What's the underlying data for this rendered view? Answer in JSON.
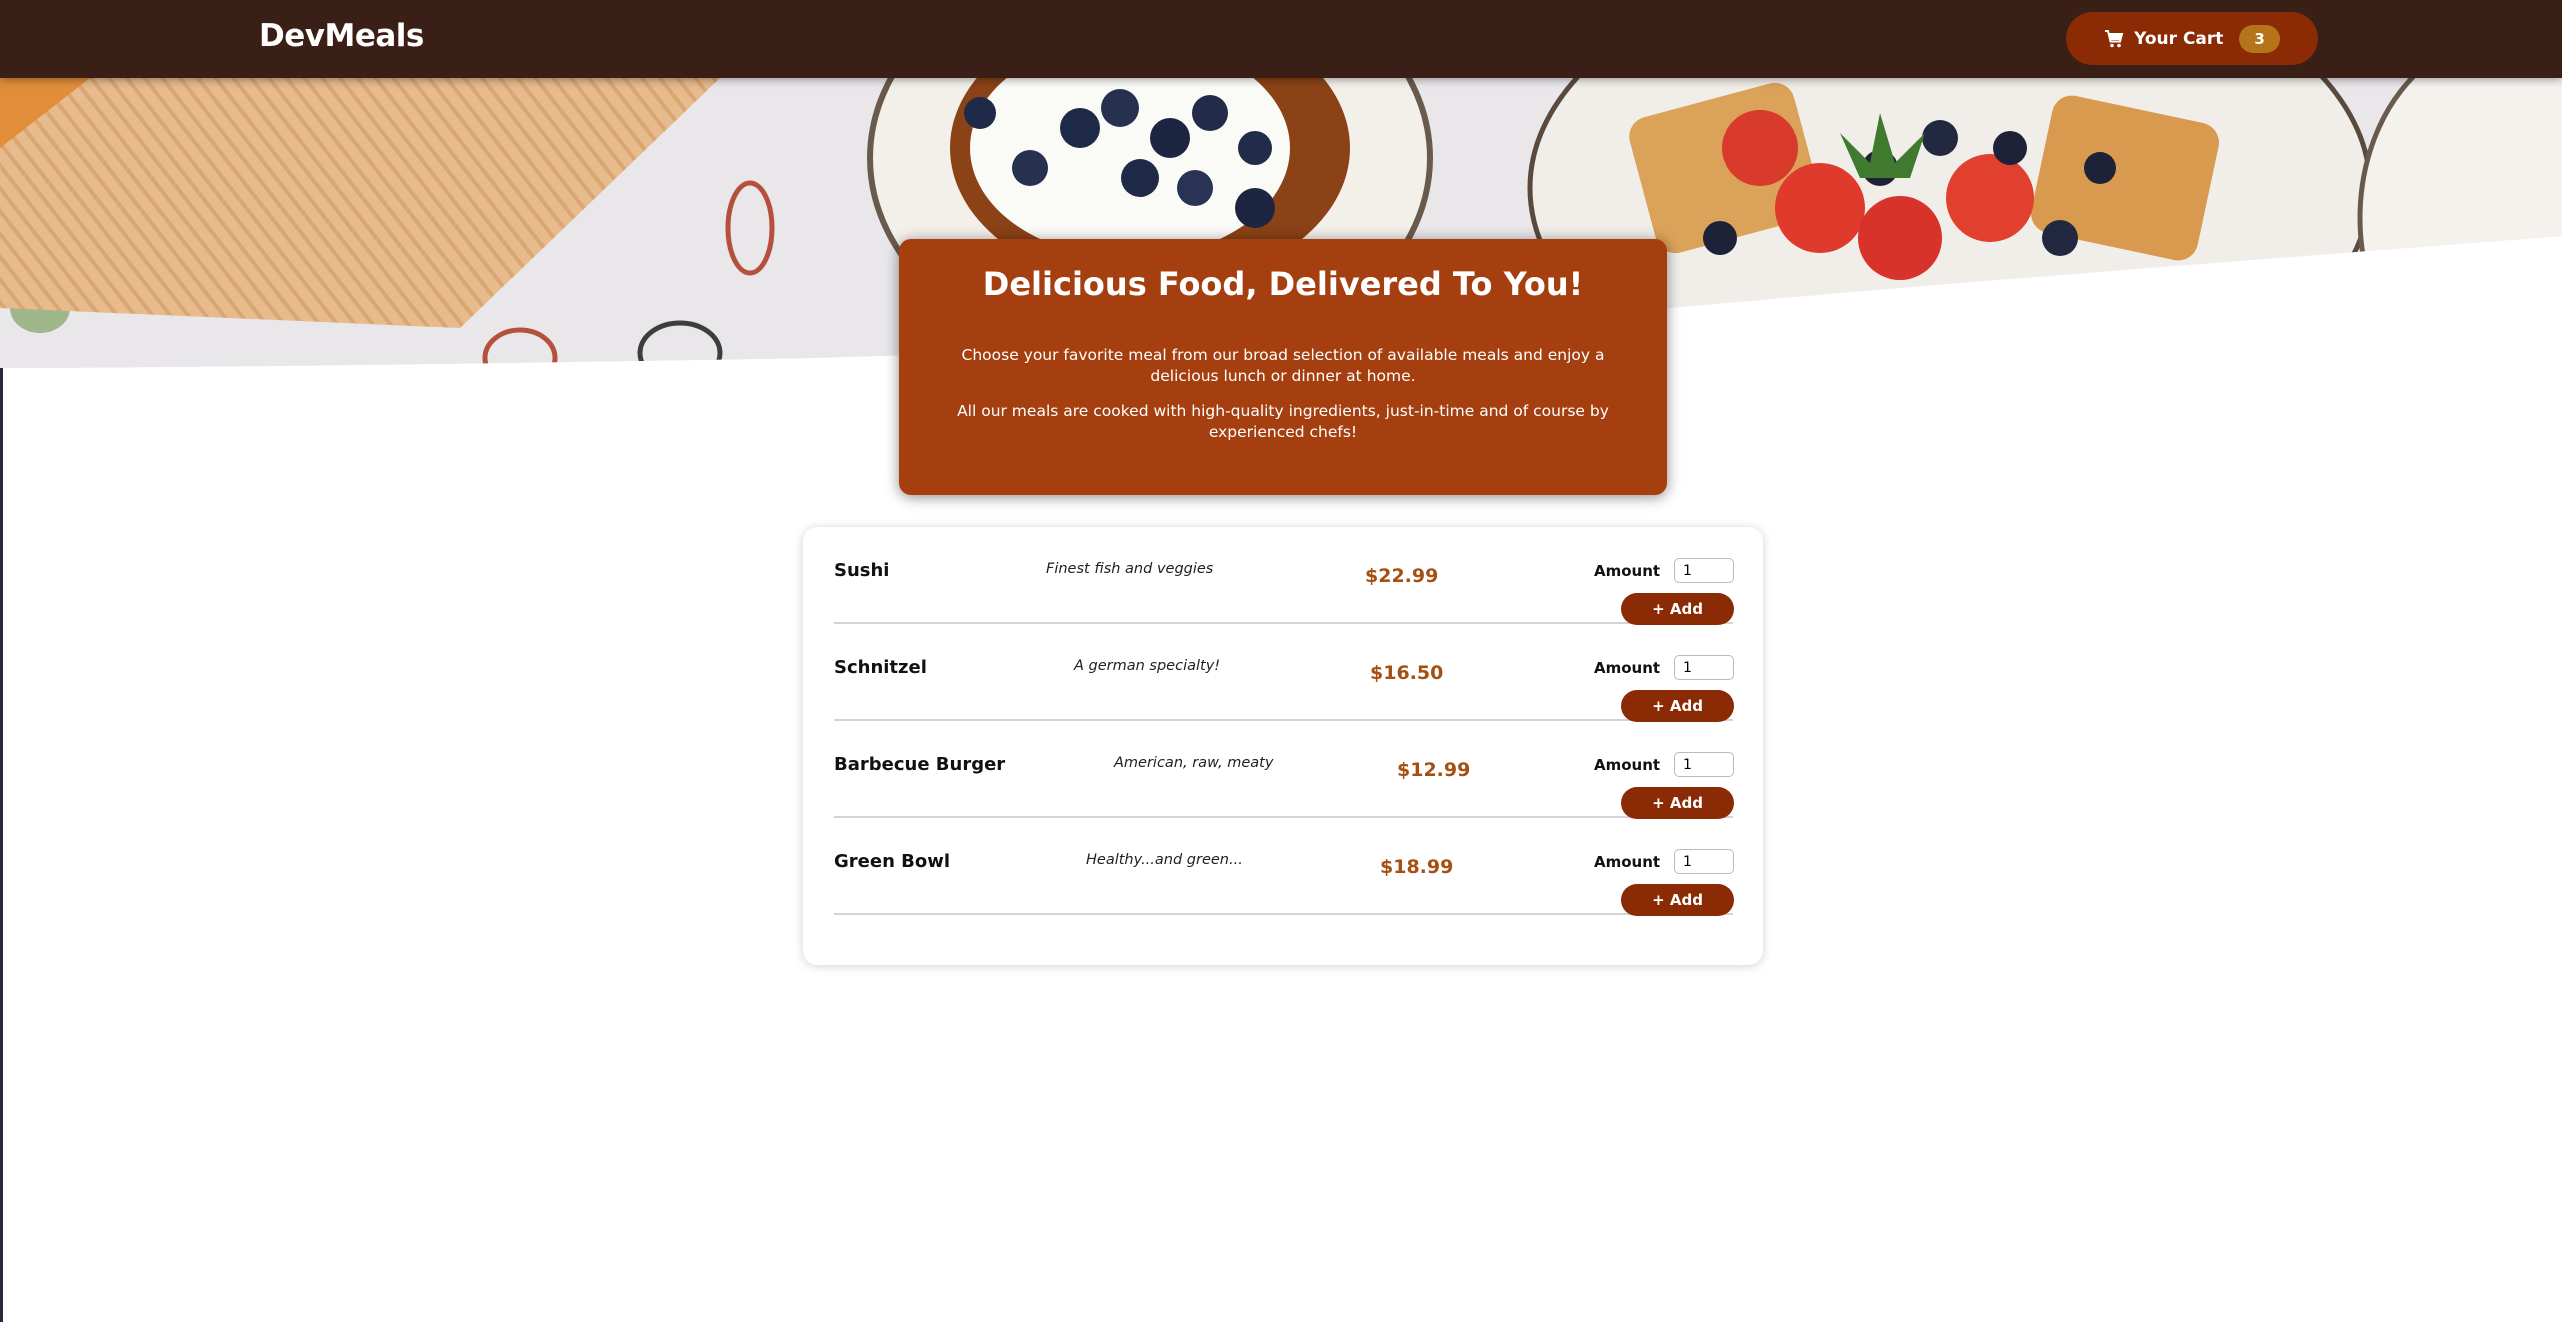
{
  "header": {
    "brand": "DevMeals",
    "cart_label": "Your Cart",
    "cart_count": "3"
  },
  "summary": {
    "title": "Delicious Food, Delivered To You!",
    "paragraph1": "Choose your favorite meal from our broad selection of available meals and enjoy a delicious lunch or dinner at home.",
    "paragraph2": "All our meals are cooked with high-quality ingredients, just-in-time and of course by experienced chefs!"
  },
  "meals": [
    {
      "name": "Sushi",
      "description": "Finest fish and veggies",
      "price": "$22.99",
      "amount_label": "Amount",
      "amount": "1",
      "add_label": "+ Add"
    },
    {
      "name": "Schnitzel",
      "description": "A german specialty!",
      "price": "$16.50",
      "amount_label": "Amount",
      "amount": "1",
      "add_label": "+ Add"
    },
    {
      "name": "Barbecue Burger",
      "description": "American, raw, meaty",
      "price": "$12.99",
      "amount_label": "Amount",
      "amount": "1",
      "add_label": "+ Add"
    },
    {
      "name": "Green Bowl",
      "description": "Healthy...and green...",
      "price": "$18.99",
      "amount_label": "Amount",
      "amount": "1",
      "add_label": "+ Add"
    }
  ],
  "colors": {
    "header_bg": "#3a1f16",
    "accent": "#8a2b06",
    "summary_bg": "#a53f10",
    "price": "#a64f12",
    "badge": "#b6741a"
  },
  "icons": {
    "cart": "shopping-cart-icon"
  }
}
